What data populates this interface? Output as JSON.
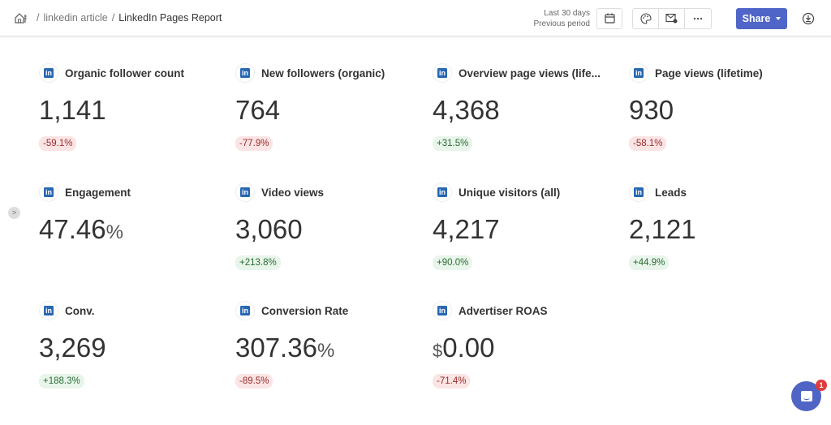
{
  "breadcrumb": {
    "home_icon": "home-icon",
    "items": [
      "linkedin article",
      "LinkedIn Pages Report"
    ]
  },
  "toolbar": {
    "period_primary": "Last 30 days",
    "period_compare": "Previous period",
    "calendar_icon": "calendar-icon",
    "theme_icon": "palette-icon",
    "email_icon": "email-schedule-icon",
    "more_icon": "more-icon",
    "share_label": "Share",
    "download_icon": "download-icon"
  },
  "colors": {
    "accent": "#5065c8",
    "linkedin": "#2867b2",
    "negative_bg": "#fbe4e4",
    "negative_text": "#9a2c2c",
    "positive_bg": "#e8f5ea",
    "positive_text": "#2b6b34"
  },
  "metrics": [
    {
      "title": "Organic follower count",
      "value": "1,141",
      "prefix": "",
      "unit": "",
      "change": "-59.1%",
      "trend": "neg"
    },
    {
      "title": "New followers (organic)",
      "value": "764",
      "prefix": "",
      "unit": "",
      "change": "-77.9%",
      "trend": "neg"
    },
    {
      "title": "Overview page views (life...",
      "value": "4,368",
      "prefix": "",
      "unit": "",
      "change": "+31.5%",
      "trend": "pos"
    },
    {
      "title": "Page views (lifetime)",
      "value": "930",
      "prefix": "",
      "unit": "",
      "change": "-58.1%",
      "trend": "neg"
    },
    {
      "title": "Engagement",
      "value": "47.46",
      "prefix": "",
      "unit": "%",
      "change": "",
      "trend": ""
    },
    {
      "title": "Video views",
      "value": "3,060",
      "prefix": "",
      "unit": "",
      "change": "+213.8%",
      "trend": "pos"
    },
    {
      "title": "Unique visitors (all)",
      "value": "4,217",
      "prefix": "",
      "unit": "",
      "change": "+90.0%",
      "trend": "pos"
    },
    {
      "title": "Leads",
      "value": "2,121",
      "prefix": "",
      "unit": "",
      "change": "+44.9%",
      "trend": "pos"
    },
    {
      "title": "Conv.",
      "value": "3,269",
      "prefix": "",
      "unit": "",
      "change": "+188.3%",
      "trend": "pos"
    },
    {
      "title": "Conversion Rate",
      "value": "307.36",
      "prefix": "",
      "unit": "%",
      "change": "-89.5%",
      "trend": "neg"
    },
    {
      "title": "Advertiser ROAS",
      "value": "0.00",
      "prefix": "$",
      "unit": "",
      "change": "-71.4%",
      "trend": "neg"
    }
  ],
  "sidebar_toggle": ">",
  "chat": {
    "unread": "1"
  }
}
